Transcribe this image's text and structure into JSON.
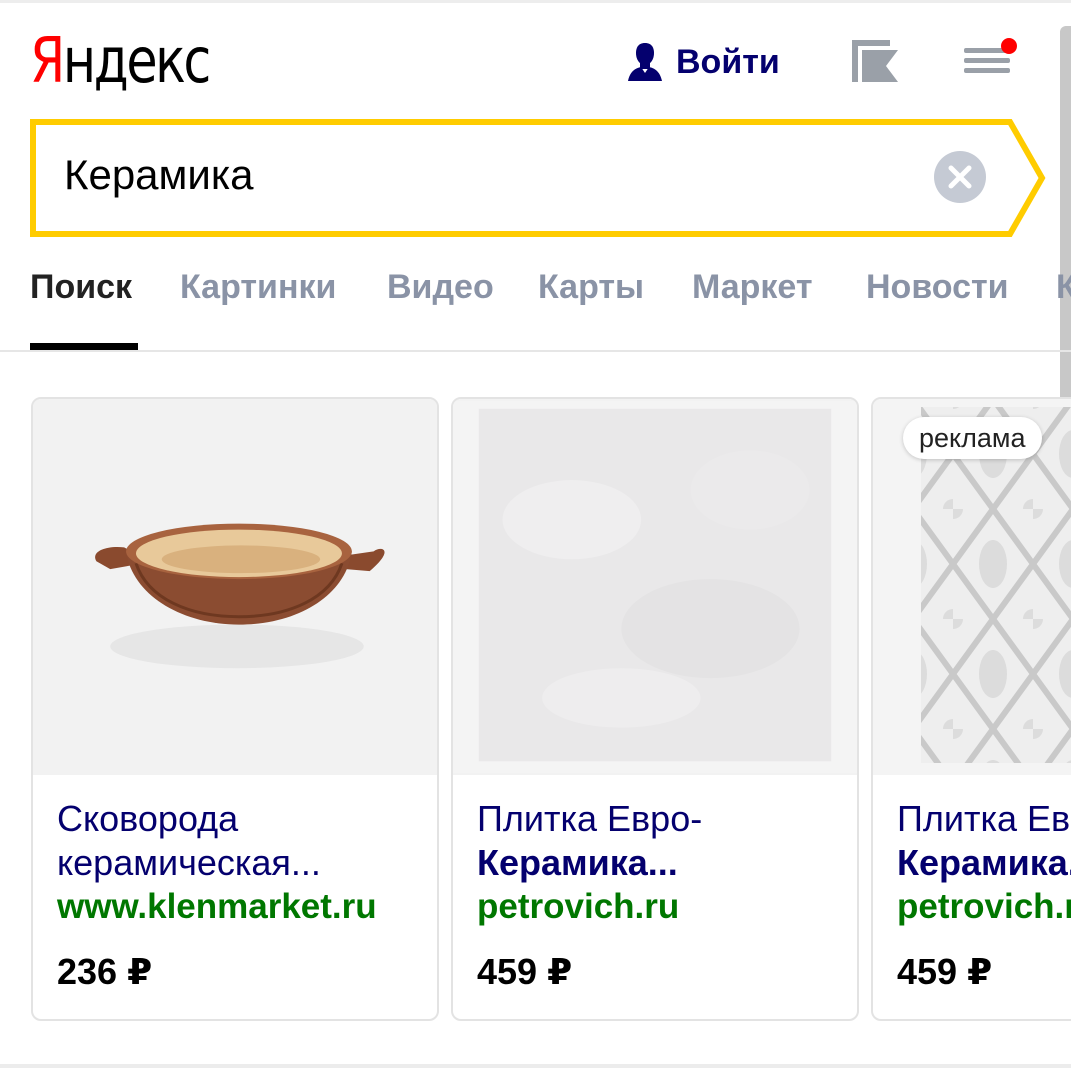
{
  "header": {
    "logo_first": "Я",
    "logo_rest": "ндекс",
    "login_label": "Войти"
  },
  "search": {
    "query": "Керамика",
    "frame_color": "#ffcc00"
  },
  "tabs": [
    {
      "label": "Поиск",
      "active": true
    },
    {
      "label": "Картинки"
    },
    {
      "label": "Видео"
    },
    {
      "label": "Карты"
    },
    {
      "label": "Маркет"
    },
    {
      "label": "Новости"
    },
    {
      "label": "К"
    }
  ],
  "products": [
    {
      "title": "Сковорода керамическая...",
      "title_bold": "",
      "site": "www.klenmarket.ru",
      "price": "236 ₽",
      "image_icon": "ceramic-dish-image"
    },
    {
      "title": "Плитка Евро-",
      "title_bold": "Керамика...",
      "site": "petrovich.ru",
      "price": "459 ₽",
      "image_icon": "tile-image"
    },
    {
      "title": "Плитка Евро-",
      "title_bold": "Керамика...",
      "site": "petrovich.ru",
      "price": "459 ₽",
      "ad_label": "реклама",
      "image_icon": "damask-tile-image"
    }
  ],
  "colors": {
    "link": "#04006e",
    "site": "#007700",
    "tab_inactive": "#8a93a6",
    "notification_dot": "#ff0000"
  }
}
